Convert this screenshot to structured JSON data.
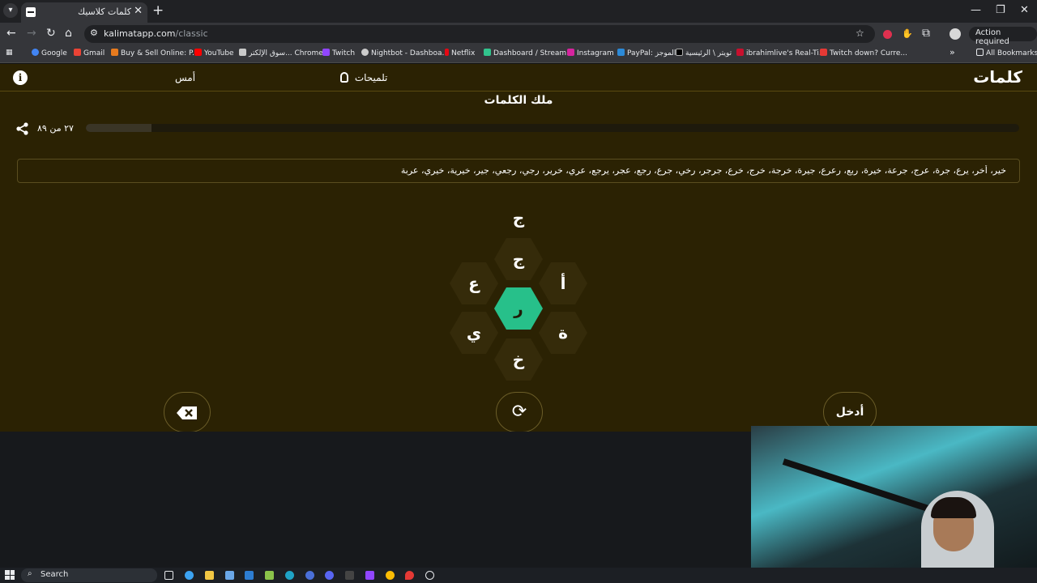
{
  "browser": {
    "tab_title": "كلمات كلاسيك",
    "tab_close": "✕",
    "new_tab": "+",
    "url_host": "kalimatapp.com",
    "url_path": "/classic",
    "action_required": "Action required",
    "bookmarks": [
      "Google",
      "Gmail",
      "Buy & Sell Online: P...",
      "YouTube",
      "سوق الإلكتر... Chrome",
      "Twitch",
      "Nightbot - Dashboa...",
      "Netflix",
      "Dashboard / Stream...",
      "Instagram",
      "PayPal: الموجز",
      "تويتر \\ الرئيسية",
      "ibrahimlive's Real-Ti...",
      "Twitch down? Curre..."
    ],
    "all_bookmarks": "All Bookmarks"
  },
  "app": {
    "logo": "كلمات",
    "yesterday": "أمس",
    "hints": "تلميحات",
    "subtitle": "ملك الكلمات",
    "count": "٢٧ من ٨٩",
    "progress": 0.07,
    "found_words": "خير، أخر، يرع، جرة، عرج، جرعة، خيرة، ربع، رعرع، جيرة، خرجة، خرج، خرع، جرجر، رخي، جرع، رجع، عجر، يرجع، عري، خرير، رجي، رجعي، جير، خيرية، خيري، عربة",
    "input_letter": "ج",
    "hive": {
      "center": "ر",
      "outer": [
        "ج",
        "أ",
        "ة",
        "خ",
        "ي",
        "ع"
      ]
    },
    "enter_label": "أدخل"
  },
  "taskbar": {
    "search": "Search"
  }
}
